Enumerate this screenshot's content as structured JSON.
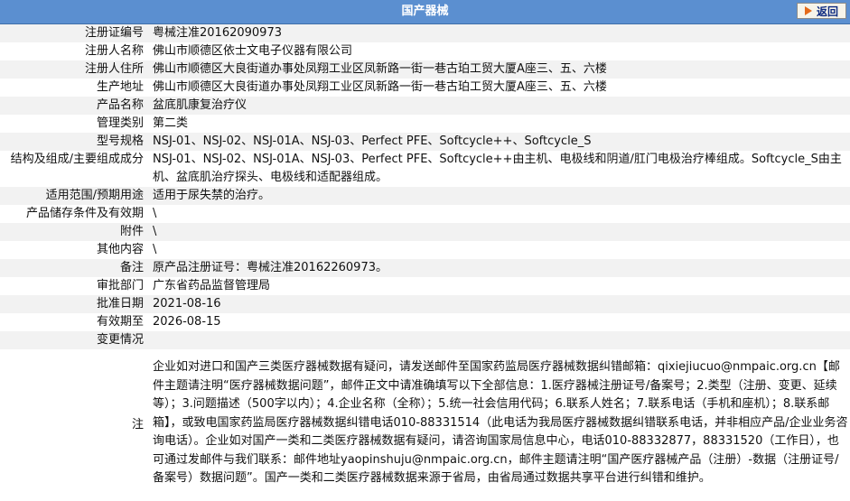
{
  "header": {
    "title": "国产器械",
    "back_label": "返回"
  },
  "rows": [
    {
      "label": "注册证编号",
      "value": "粤械注准20162090973"
    },
    {
      "label": "注册人名称",
      "value": "佛山市顺德区依士文电子仪器有限公司"
    },
    {
      "label": "注册人住所",
      "value": "佛山市顺德区大良街道办事处凤翔工业区凤新路一街一巷古珀工贸大厦A座三、五、六楼"
    },
    {
      "label": "生产地址",
      "value": "佛山市顺德区大良街道办事处凤翔工业区凤新路一街一巷古珀工贸大厦A座三、五、六楼"
    },
    {
      "label": "产品名称",
      "value": "盆底肌康复治疗仪"
    },
    {
      "label": "管理类别",
      "value": "第二类"
    },
    {
      "label": "型号规格",
      "value": "NSJ-01、NSJ-02、NSJ-01A、NSJ-03、Perfect PFE、Softcycle++、Softcycle_S"
    },
    {
      "label": "结构及组成/主要组成成分",
      "value": "NSJ-01、NSJ-02、NSJ-01A、NSJ-03、Perfect PFE、Softcycle++由主机、电极线和阴道/肛门电极治疗棒组成。Softcycle_S由主机、盆底肌治疗探头、电极线和适配器组成。"
    },
    {
      "label": "适用范围/预期用途",
      "value": "适用于尿失禁的治疗。"
    },
    {
      "label": "产品储存条件及有效期",
      "value": "\\"
    },
    {
      "label": "附件",
      "value": "\\"
    },
    {
      "label": "其他内容",
      "value": "\\"
    },
    {
      "label": "备注",
      "value": "原产品注册证号：粤械注准20162260973。"
    },
    {
      "label": "审批部门",
      "value": "广东省药品监督管理局"
    },
    {
      "label": "批准日期",
      "value": "2021-08-16"
    },
    {
      "label": "有效期至",
      "value": "2026-08-15"
    },
    {
      "label": "变更情况",
      "value": ""
    }
  ],
  "note": {
    "label": "注",
    "text": "企业如对进口和国产三类医疗器械数据有疑问，请发送邮件至国家药监局医疗器械数据纠错邮箱：qixiejiucuo@nmpaic.org.cn【邮件主题请注明“医疗器械数据问题”，邮件正文中请准确填写以下全部信息：1.医疗器械注册证号/备案号；2.类型（注册、变更、延续等）；3.问题描述（500字以内）；4.企业名称（全称）；5.统一社会信用代码；6.联系人姓名；7.联系电话（手机和座机）；8.联系邮箱】，或致电国家药监局医疗器械数据纠错电话010-88331514（此电话为我局医疗器械数据纠错联系电话，并非相应产品/企业业务咨询电话）。企业如对国产一类和二类医疗器械数据有疑问，请咨询国家局信息中心，电话010-88332877，88331520（工作日），也可通过发邮件与我们联系：邮件地址yaopinshuju@nmpaic.org.cn，邮件主题请注明“国产医疗器械产品（注册）-数据（注册证号/备案号）数据问题”。国产一类和二类医疗器械数据来源于省局，由省局通过数据共享平台进行纠错和维护。"
  }
}
